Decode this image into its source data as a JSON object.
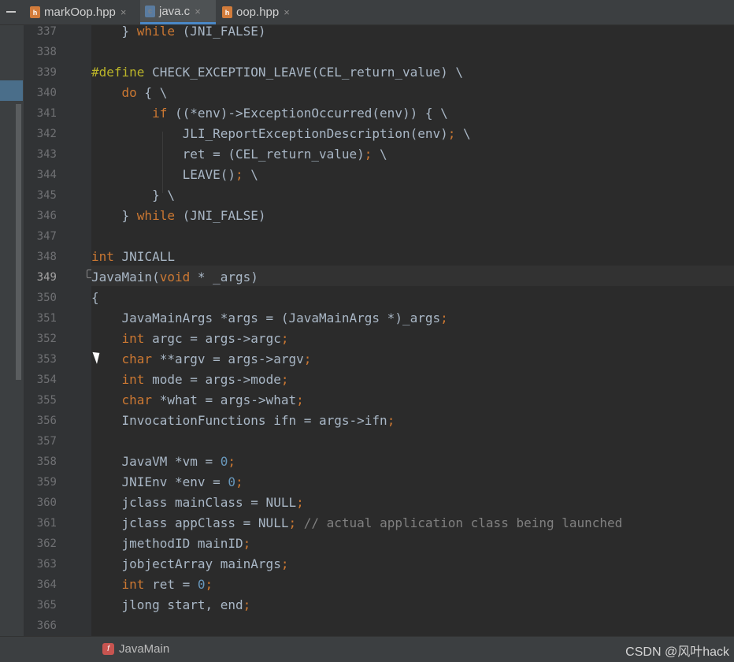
{
  "tabs": [
    {
      "label": "markOop.hpp",
      "icon": "h-file-icon",
      "glyph": "h",
      "active": false
    },
    {
      "label": "java.c",
      "icon": "c-file-icon",
      "glyph": "c",
      "active": true
    },
    {
      "label": "oop.hpp",
      "icon": "h-file-icon",
      "glyph": "h",
      "active": false
    }
  ],
  "tab_close_glyph": "×",
  "code_lines": [
    {
      "num": "337",
      "text": "    } while (JNI_FALSE)"
    },
    {
      "num": "338",
      "text": ""
    },
    {
      "num": "339",
      "text": "#define CHECK_EXCEPTION_LEAVE(CEL_return_value) \\"
    },
    {
      "num": "340",
      "text": "    do { \\"
    },
    {
      "num": "341",
      "text": "        if ((*env)->ExceptionOccurred(env)) { \\"
    },
    {
      "num": "342",
      "text": "            JLI_ReportExceptionDescription(env); \\"
    },
    {
      "num": "343",
      "text": "            ret = (CEL_return_value); \\"
    },
    {
      "num": "344",
      "text": "            LEAVE(); \\"
    },
    {
      "num": "345",
      "text": "        } \\"
    },
    {
      "num": "346",
      "text": "    } while (JNI_FALSE)"
    },
    {
      "num": "347",
      "text": ""
    },
    {
      "num": "348",
      "text": "int JNICALL"
    },
    {
      "num": "349",
      "text": "JavaMain(void * _args)"
    },
    {
      "num": "350",
      "text": "{"
    },
    {
      "num": "351",
      "text": "    JavaMainArgs *args = (JavaMainArgs *)_args;"
    },
    {
      "num": "352",
      "text": "    int argc = args->argc;"
    },
    {
      "num": "353",
      "text": "    char **argv = args->argv;"
    },
    {
      "num": "354",
      "text": "    int mode = args->mode;"
    },
    {
      "num": "355",
      "text": "    char *what = args->what;"
    },
    {
      "num": "356",
      "text": "    InvocationFunctions ifn = args->ifn;"
    },
    {
      "num": "357",
      "text": ""
    },
    {
      "num": "358",
      "text": "    JavaVM *vm = 0;"
    },
    {
      "num": "359",
      "text": "    JNIEnv *env = 0;"
    },
    {
      "num": "360",
      "text": "    jclass mainClass = NULL;"
    },
    {
      "num": "361",
      "text": "    jclass appClass = NULL; // actual application class being launched"
    },
    {
      "num": "362",
      "text": "    jmethodID mainID;"
    },
    {
      "num": "363",
      "text": "    jobjectArray mainArgs;"
    },
    {
      "num": "364",
      "text": "    int ret = 0;"
    },
    {
      "num": "365",
      "text": "    jlong start, end;"
    },
    {
      "num": "366",
      "text": ""
    }
  ],
  "current_line": "349",
  "breadcrumb": {
    "label": "JavaMain",
    "icon": "function-icon",
    "glyph": "f"
  },
  "watermark": "CSDN @风叶hack",
  "colors": {
    "background": "#2b2b2b",
    "keyword": "#cc7832",
    "macro": "#bbb529",
    "number": "#6897bb",
    "comment": "#808080",
    "text": "#a9b7c6"
  }
}
